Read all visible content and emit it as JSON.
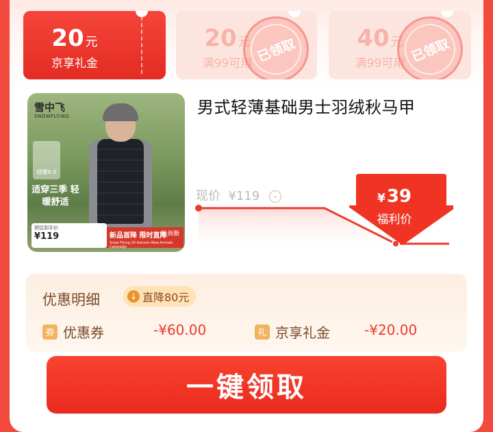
{
  "coupons": [
    {
      "amount": "20",
      "unit": "元",
      "desc": "京享礼金",
      "state": "active"
    },
    {
      "amount": "20",
      "unit": "元",
      "desc": "满99可用",
      "state": "claimed",
      "stamp": "已领取"
    },
    {
      "amount": "40",
      "unit": "元",
      "desc": "满99可用",
      "state": "claimed",
      "stamp": "已领取"
    }
  ],
  "product": {
    "title": "男式轻薄基础男士羽绒秋马甲",
    "image": {
      "brand": "雪中飞",
      "brand_sub": "SNOWFLYING",
      "badge": "轻暖6.0",
      "slogan": "适穿三季 轻暖舒适",
      "price_label": "预估到手价",
      "price": "¥119",
      "promo": "新品首降 限时直降",
      "promo_sub": "Snow Flying 20 Autumn New Arrivals Campaign",
      "seal": "秋尚新"
    }
  },
  "price": {
    "now_label": "现价",
    "now_value": "¥119",
    "deal_symbol": "¥",
    "deal_value": "39",
    "deal_label": "福利价"
  },
  "detail": {
    "title": "优惠明细",
    "badge": "直降80元",
    "items": [
      {
        "tag": "券",
        "name": "优惠券",
        "amount": "-¥60.00"
      },
      {
        "tag": "礼",
        "name": "京享礼金",
        "amount": "-¥20.00"
      }
    ]
  },
  "cta": {
    "label": "一键领取"
  },
  "colors": {
    "primary_red": "#e92a1e",
    "claimed_pink": "#fde5df",
    "detail_brown": "#7a4a2a"
  }
}
